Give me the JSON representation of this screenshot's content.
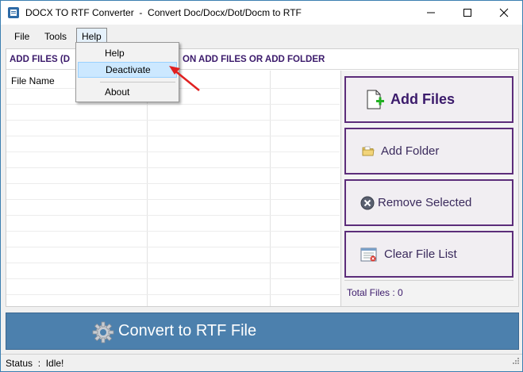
{
  "window": {
    "title": "DOCX TO RTF Converter  -  Convert Doc/Docx/Dot/Docm to RTF"
  },
  "menu": {
    "file": "File",
    "tools": "Tools",
    "help": "Help"
  },
  "help_menu": {
    "items": [
      "Help",
      "Deactivate",
      "About"
    ]
  },
  "files": {
    "header_left": "ADD FILES (D",
    "header_right": "ON ADD FILES OR ADD FOLDER",
    "column_file_name": "File Name"
  },
  "actions": {
    "add_files": "Add Files",
    "add_folder": "Add Folder",
    "remove_selected": "Remove Selected",
    "clear_file_list": "Clear File List",
    "total_files": "Total Files : 0"
  },
  "convert": {
    "label": "Convert to RTF File"
  },
  "status": {
    "text": "Status  :  Idle!"
  },
  "colors": {
    "accent_purple": "#3b1a6b",
    "convert_blue": "#4c80ad",
    "highlight": "#cce8ff",
    "arrow_red": "#e02020"
  },
  "icons": [
    "app-icon",
    "minimize-icon",
    "maximize-icon",
    "close-icon",
    "new-file-icon",
    "folder-icon",
    "remove-icon",
    "clear-list-icon",
    "gear-icon",
    "size-grip-icon",
    "pointer-arrow-icon"
  ]
}
